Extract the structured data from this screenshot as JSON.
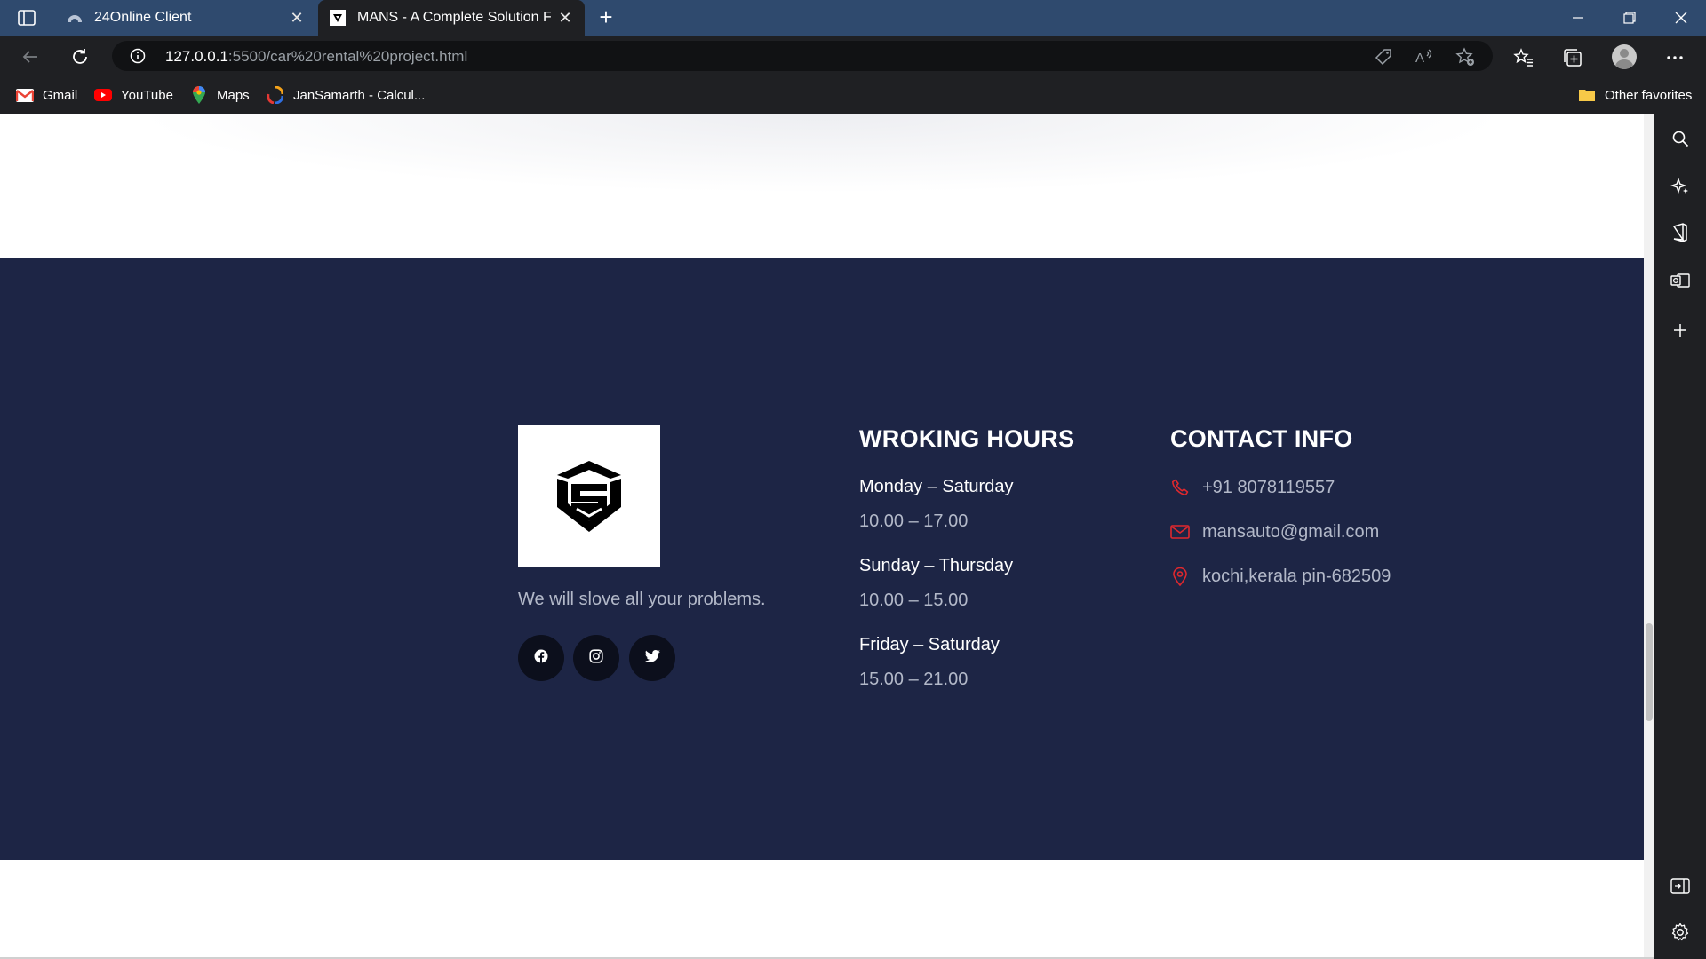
{
  "browser": {
    "tabs": [
      {
        "title": "24Online Client",
        "active": false,
        "icon": "cloud-icon"
      },
      {
        "title": "MANS - A Complete Solution For",
        "active": true,
        "icon": "site-logo-icon"
      }
    ],
    "url": {
      "host": "127.0.0.1",
      "rest": ":5500/car%20rental%20project.html"
    },
    "favorites": [
      {
        "label": "Gmail",
        "icon": "gmail-icon"
      },
      {
        "label": "YouTube",
        "icon": "youtube-icon"
      },
      {
        "label": "Maps",
        "icon": "maps-icon"
      },
      {
        "label": "JanSamarth - Calcul...",
        "icon": "jansamarth-icon"
      }
    ],
    "other_favorites": "Other favorites"
  },
  "footer": {
    "tagline": "We will slove all your problems.",
    "social": [
      "facebook-icon",
      "instagram-icon",
      "twitter-icon"
    ],
    "hours": {
      "title": "WROKING HOURS",
      "items": [
        {
          "day": "Monday – Saturday",
          "time": "10.00 – 17.00"
        },
        {
          "day": "Sunday – Thursday",
          "time": "10.00 – 15.00"
        },
        {
          "day": "Friday – Saturday",
          "time": "15.00 – 21.00"
        }
      ]
    },
    "contact": {
      "title": "CONTACT INFO",
      "phone": "+91 8078119557",
      "email": "mansauto@gmail.com",
      "address": "kochi,kerala pin-682509"
    }
  },
  "colors": {
    "footer_bg": "#1d2545",
    "accent_icon": "#e0282e",
    "tab_bar": "#2f4a6e"
  }
}
